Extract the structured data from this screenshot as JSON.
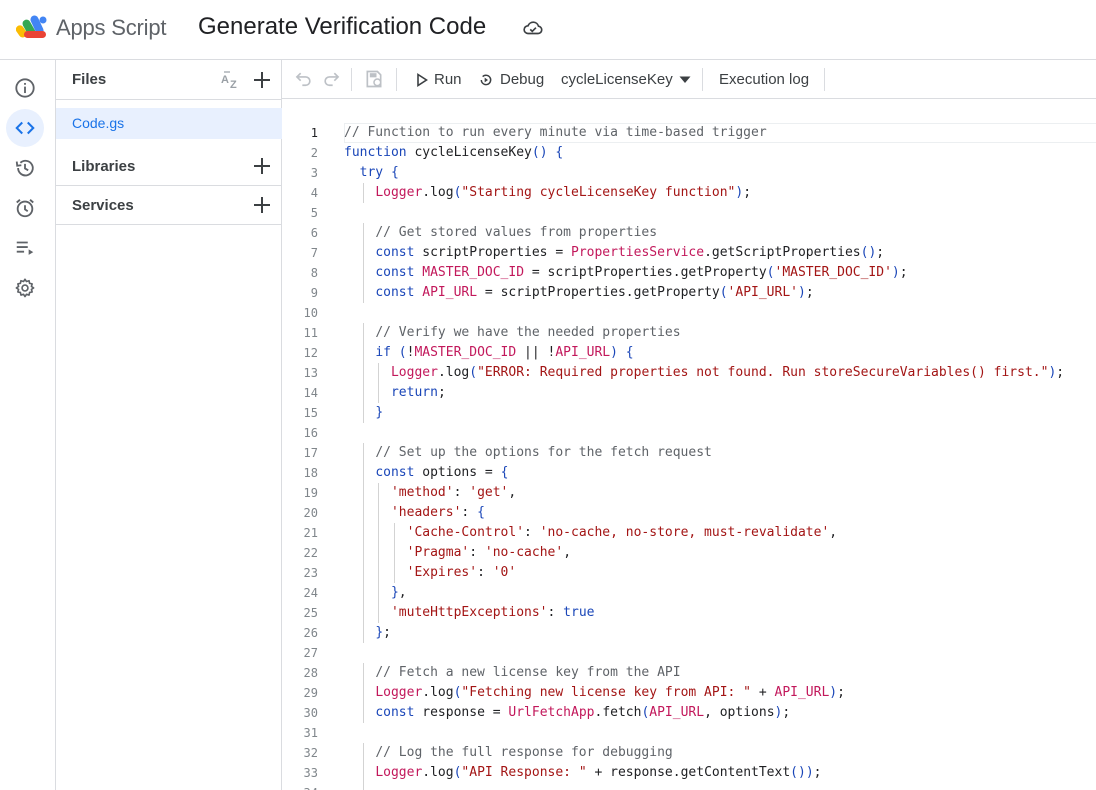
{
  "colors": {
    "accent": "#1a73e8",
    "selected_bg": "#e8f0fe",
    "border": "#dadce0",
    "keyword": "#1a46b8",
    "string": "#a31515",
    "service": "#c2185b",
    "comment": "#5f6368"
  },
  "header": {
    "app_name": "Apps Script",
    "project_title": "Generate Verification Code",
    "logo_icon": "apps-script-logo",
    "cloud_icon": "cloud-saved-icon"
  },
  "rail": {
    "items": [
      {
        "icon": "info-icon",
        "label": "Overview"
      },
      {
        "icon": "code-icon",
        "label": "Editor",
        "active": true
      },
      {
        "icon": "history-icon",
        "label": "Project History"
      },
      {
        "icon": "alarm-icon",
        "label": "Triggers"
      },
      {
        "icon": "executions-icon",
        "label": "Executions"
      },
      {
        "icon": "gear-icon",
        "label": "Project Settings"
      }
    ]
  },
  "files_panel": {
    "title": "Files",
    "sort_icon": "sort-az-icon",
    "files": [
      {
        "name": "Code.gs",
        "selected": true
      }
    ],
    "sections": [
      {
        "label": "Libraries"
      },
      {
        "label": "Services"
      }
    ]
  },
  "toolbar": {
    "undo_icon": "undo-icon",
    "redo_icon": "redo-icon",
    "save_icon": "save-icon",
    "run_label": "Run",
    "debug_label": "Debug",
    "function_select": "cycleLicenseKey",
    "execution_log_label": "Execution log"
  },
  "editor": {
    "active_line": 1,
    "lines": [
      "// Function to run every minute via time-based trigger",
      "function cycleLicenseKey() {",
      "  try {",
      "    Logger.log(\"Starting cycleLicenseKey function\");",
      "",
      "    // Get stored values from properties",
      "    const scriptProperties = PropertiesService.getScriptProperties();",
      "    const MASTER_DOC_ID = scriptProperties.getProperty('MASTER_DOC_ID');",
      "    const API_URL = scriptProperties.getProperty('API_URL');",
      "",
      "    // Verify we have the needed properties",
      "    if (!MASTER_DOC_ID || !API_URL) {",
      "      Logger.log(\"ERROR: Required properties not found. Run storeSecureVariables() first.\");",
      "      return;",
      "    }",
      "",
      "    // Set up the options for the fetch request",
      "    const options = {",
      "      'method': 'get',",
      "      'headers': {",
      "        'Cache-Control': 'no-cache, no-store, must-revalidate',",
      "        'Pragma': 'no-cache',",
      "        'Expires': '0'",
      "      },",
      "      'muteHttpExceptions': true",
      "    };",
      "",
      "    // Fetch a new license key from the API",
      "    Logger.log(\"Fetching new license key from API: \" + API_URL);",
      "    const response = UrlFetchApp.fetch(API_URL, options);",
      "",
      "    // Log the full response for debugging",
      "    Logger.log(\"API Response: \" + response.getContentText());",
      "    "
    ]
  }
}
